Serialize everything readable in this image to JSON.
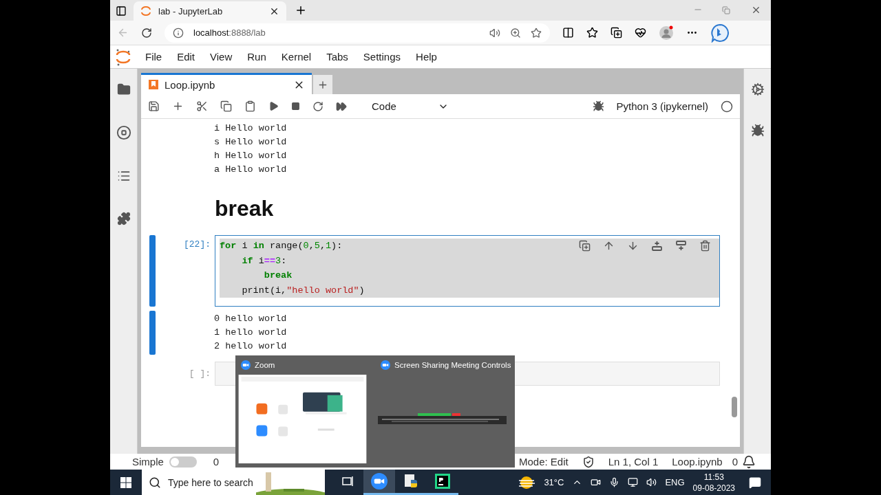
{
  "browser": {
    "tab_title": "lab - JupyterLab",
    "address_host": "localhost",
    "address_path": ":8888/lab"
  },
  "menu": [
    "File",
    "Edit",
    "View",
    "Run",
    "Kernel",
    "Tabs",
    "Settings",
    "Help"
  ],
  "notebook_tab": {
    "title": "Loop.ipynb",
    "selected": true
  },
  "toolbar": {
    "cell_type": "Code",
    "kernel": "Python 3 (ipykernel)"
  },
  "cells": [
    {
      "kind": "output",
      "selected": false,
      "lines": [
        "i Hello world",
        "s Hello world",
        "h Hello world",
        "a Hello world"
      ]
    },
    {
      "kind": "markdown",
      "selected": false,
      "heading": "break"
    },
    {
      "kind": "code",
      "selected": true,
      "prompt": "[22]:",
      "lines": [
        [
          {
            "kind": "keyword",
            "text": "for"
          },
          {
            "kind": "plain",
            "text": " i "
          },
          {
            "kind": "keyword",
            "text": "in"
          },
          {
            "kind": "plain",
            "text": " range("
          },
          {
            "kind": "number",
            "text": "0"
          },
          {
            "kind": "plain",
            "text": ","
          },
          {
            "kind": "number",
            "text": "5"
          },
          {
            "kind": "plain",
            "text": ","
          },
          {
            "kind": "number",
            "text": "1"
          },
          {
            "kind": "plain",
            "text": "):"
          }
        ],
        [
          {
            "kind": "keyword",
            "text": "    if"
          },
          {
            "kind": "plain",
            "text": " i"
          },
          {
            "kind": "operator",
            "text": "=="
          },
          {
            "kind": "number",
            "text": "3"
          },
          {
            "kind": "plain",
            "text": ":"
          }
        ],
        [
          {
            "kind": "keyword",
            "text": "        break"
          }
        ],
        [
          {
            "kind": "plain",
            "text": "    print(i,"
          },
          {
            "kind": "string",
            "text": "\"hello world\""
          },
          {
            "kind": "plain",
            "text": ")"
          }
        ]
      ]
    },
    {
      "kind": "output",
      "selected": true,
      "lines": [
        "0 hello world",
        "1 hello world",
        "2 hello world"
      ]
    },
    {
      "kind": "code",
      "selected": false,
      "prompt": "[ ]:"
    }
  ],
  "popup": {
    "items": [
      {
        "title": "Zoom",
        "kind": "picture"
      },
      {
        "title": "Screen Sharing Meeting Controls",
        "kind": "picture"
      }
    ]
  },
  "status_bar": {
    "label": "Simple",
    "simple_on": false,
    "count": "0",
    "mode": "Mode: Edit",
    "position": "Ln 1, Col 1",
    "file": "Loop.ipynb",
    "notifications": "0"
  },
  "taskbar": {
    "search_placeholder": "Type here to search",
    "apps": [
      {
        "kind": "taskview",
        "active": false,
        "running": false
      },
      {
        "kind": "zoom",
        "active": true,
        "running": true
      },
      {
        "kind": "python",
        "active": false,
        "running": true
      },
      {
        "kind": "pycharm",
        "active": false,
        "running": true
      }
    ],
    "weather": "31°C",
    "language": "ENG",
    "time": "11:53",
    "date": "09-08-2023"
  }
}
